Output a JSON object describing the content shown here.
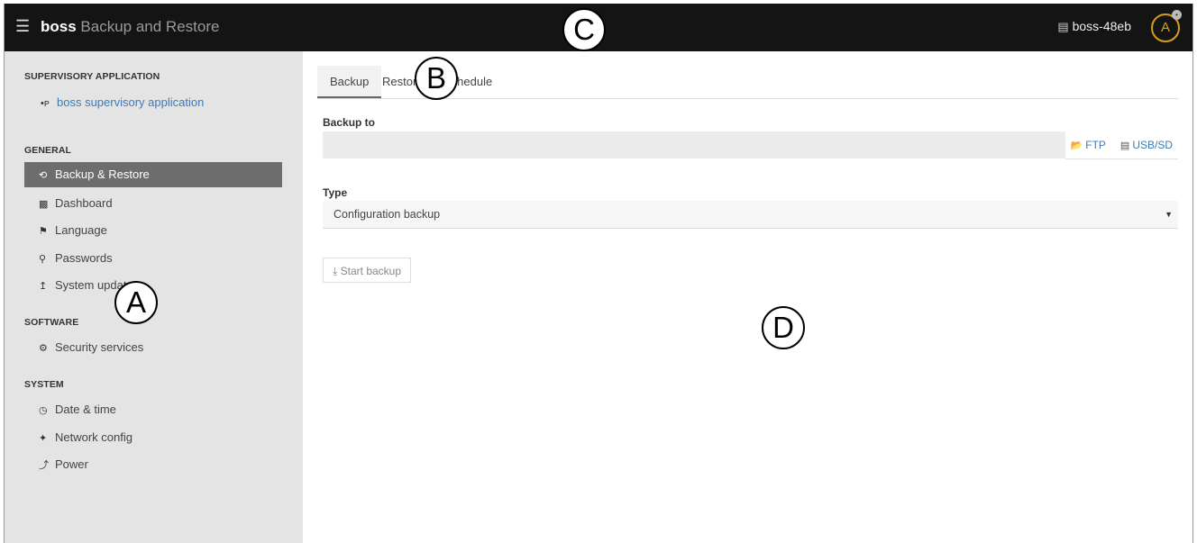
{
  "header": {
    "app_bold": "boss",
    "app_rest": " Backup and Restore",
    "device_name": "boss-48eb",
    "avatar_letter": "A"
  },
  "sidebar": {
    "sections": [
      {
        "title": "SUPERVISORY APPLICATION",
        "items": [
          {
            "label": "boss supervisory application",
            "icon": "boss-logo-icon"
          }
        ]
      },
      {
        "title": "GENERAL",
        "items": [
          {
            "label": "Backup & Restore",
            "icon": "history-icon",
            "active": true
          },
          {
            "label": "Dashboard",
            "icon": "bar-chart-icon"
          },
          {
            "label": "Language",
            "icon": "flag-icon"
          },
          {
            "label": "Passwords",
            "icon": "key-icon"
          },
          {
            "label": "System update",
            "icon": "upload-icon"
          }
        ]
      },
      {
        "title": "SOFTWARE",
        "items": [
          {
            "label": "Security services",
            "icon": "cogs-icon"
          }
        ]
      },
      {
        "title": "SYSTEM",
        "items": [
          {
            "label": "Date & time",
            "icon": "clock-icon"
          },
          {
            "label": "Network config",
            "icon": "plug-icon"
          },
          {
            "label": "Power",
            "icon": "bolt-icon"
          }
        ]
      }
    ]
  },
  "main": {
    "tabs": [
      "Backup",
      "Restore",
      "Schedule"
    ],
    "active_tab": "Backup",
    "backup_to_label": "Backup to",
    "destinations": [
      "FTP",
      "USB/SD"
    ],
    "type_label": "Type",
    "type_value": "Configuration backup",
    "start_button": "Start backup"
  },
  "callouts": [
    "A",
    "B",
    "C",
    "D"
  ],
  "colors": {
    "topbar": "#141414",
    "sidebar": "#e4e4e4",
    "active_item": "#6d6d6d",
    "link": "#3a7bbf",
    "avatar": "#d4a017"
  }
}
